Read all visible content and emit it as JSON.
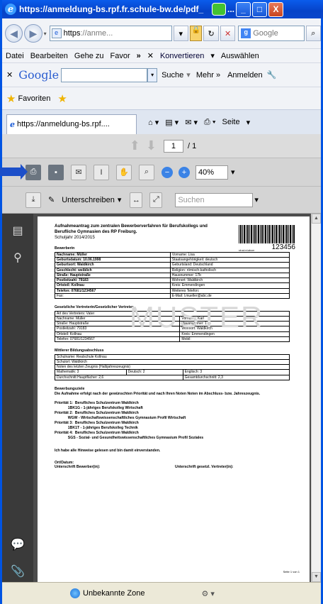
{
  "window": {
    "title": "https://anmeldung-bs.rpf.fr.schule-bw.de/pdf_",
    "title_suffix": "...",
    "minimize": "_",
    "maximize": "□",
    "close": "X"
  },
  "address": {
    "url_bold": "https",
    "url_rest": "://anme...",
    "search_placeholder": "Google"
  },
  "menu": [
    "Datei",
    "Bearbeiten",
    "Gehe zu",
    "Favor",
    "»",
    "✕",
    "Konvertieren",
    "▾",
    "Auswählen"
  ],
  "googlebar": {
    "logo": "Google",
    "search_label": "Suche",
    "more": "Mehr »",
    "signin": "Anmelden"
  },
  "favorites": {
    "label": "Favoriten"
  },
  "tab": {
    "label": "https://anmeldung-bs.rpf....",
    "page_label": "Seite"
  },
  "pdf": {
    "page_current": "1",
    "page_total": "/ 1",
    "zoom": "40%",
    "sign_label": "Unterschreiben",
    "search_placeholder": "Suchen"
  },
  "document": {
    "title": "Aufnahmeantrag zum zentralen Bewerberverfahren für Berufskollegs und Berufliche Gymnasien des RP Freiburg.",
    "year": "Schuljahr 2014/2015",
    "barcode_small": "sb.sd.rd.abcer",
    "barcode_number": "123456",
    "watermark": "MUSTER",
    "applicant_title": "Bewerberin",
    "applicant": [
      [
        "Nachname: Müller",
        "Vorname: Lisa"
      ],
      [
        "Geburtsdatum: 10.06.1998",
        "Staatsangehörigkeit: deutsch"
      ],
      [
        "Geburtsort: Waldkirch",
        "Geburtsland: Deutschland"
      ],
      [
        "Geschlecht: weiblich",
        "Religion: römisch-katholisch"
      ],
      [
        "Straße: Hauptstraße",
        "Hausnummer: 17b"
      ],
      [
        "Postleitzahl: 79183",
        "Wohnort: Waldkirch"
      ],
      [
        "Ortsteil: Kollnau",
        "Kreis: Emmendingen"
      ],
      [
        "Telefon: 07681/1234567",
        "Weiteres Telefon:"
      ],
      [
        "Fax:",
        "E-Mail: l.mueller@abc.de"
      ]
    ],
    "guardian_title": "Gesetzliche Vertreterin/Gesetzlicher Vertreter",
    "guardian_type": "Art des Vertreters: Vater",
    "guardian": [
      [
        "Nachname: Müller",
        "Vorname: Karl"
      ],
      [
        "Straße: Hauptstraße",
        "Hausnummer: 17b"
      ],
      [
        "Postleitzahl: 79183",
        "Wohnort: Waldkirch"
      ],
      [
        "Ortsteil: Kollnau",
        "Kreis: Emmendingen"
      ],
      [
        "Telefon: 07681/1234567",
        "Mobil:"
      ]
    ],
    "school_title": "Mittlerer Bildungsabschluss",
    "school_name": "Schulname: Realschule Kollnau",
    "school_place": "Schulort: Waldkirch",
    "grades_label": "Noten des letzten Zeugnis (Halbjahreszeugnis)",
    "grades": [
      "Mathematik: 3",
      "Deutsch: 2",
      "Englisch: 3"
    ],
    "averages": [
      "Durchschnitt Hauptfächer: 2,6",
      "Gesamtdurchschnitt: 2,3"
    ],
    "wish_title": "Bewerbungsziele",
    "wish_text": "Die Aufnahme erfolgt nach der gewünschten Priorität und nach Ihren Noten Noten im Abschluss- bzw. Jahreszeugnis.",
    "priorities": [
      "Priorität 1:  Berufliches Schulzentrum Waldkirch",
      "             1BK1G - 1-jähriges Berufskolleg Wirtschaft",
      "Priorität 2:  Berufliches Schulzentrum Waldkirch",
      "             WGW - Wirtschaftswissenschaftliches Gymnasium Profil Wirtschaft",
      "Priorität 3:  Berufliches Schulzentrum Waldkirch",
      "             1BK1T - 1-jähriges Berufskolleg Technik",
      "Priorität 4:  Berufliches Schulzentrum Waldkirch",
      "             SGS - Sozial- und Gesundheitswissenschaftliches Gymnasium Profil Soziales"
    ],
    "confirm": "Ich habe alle Hinweise gelesen und bin damit einverstanden.",
    "date_label": "Ort/Datum:",
    "sig_applicant": "Unterschrift Bewerber(in):",
    "sig_guardian": "Unterschrift gesetzl. Vertreter(in):",
    "page_num": "Seite 1 von 1"
  },
  "status": {
    "zone": "Unbekannte Zone",
    "zoom": "⚙ ▾"
  }
}
